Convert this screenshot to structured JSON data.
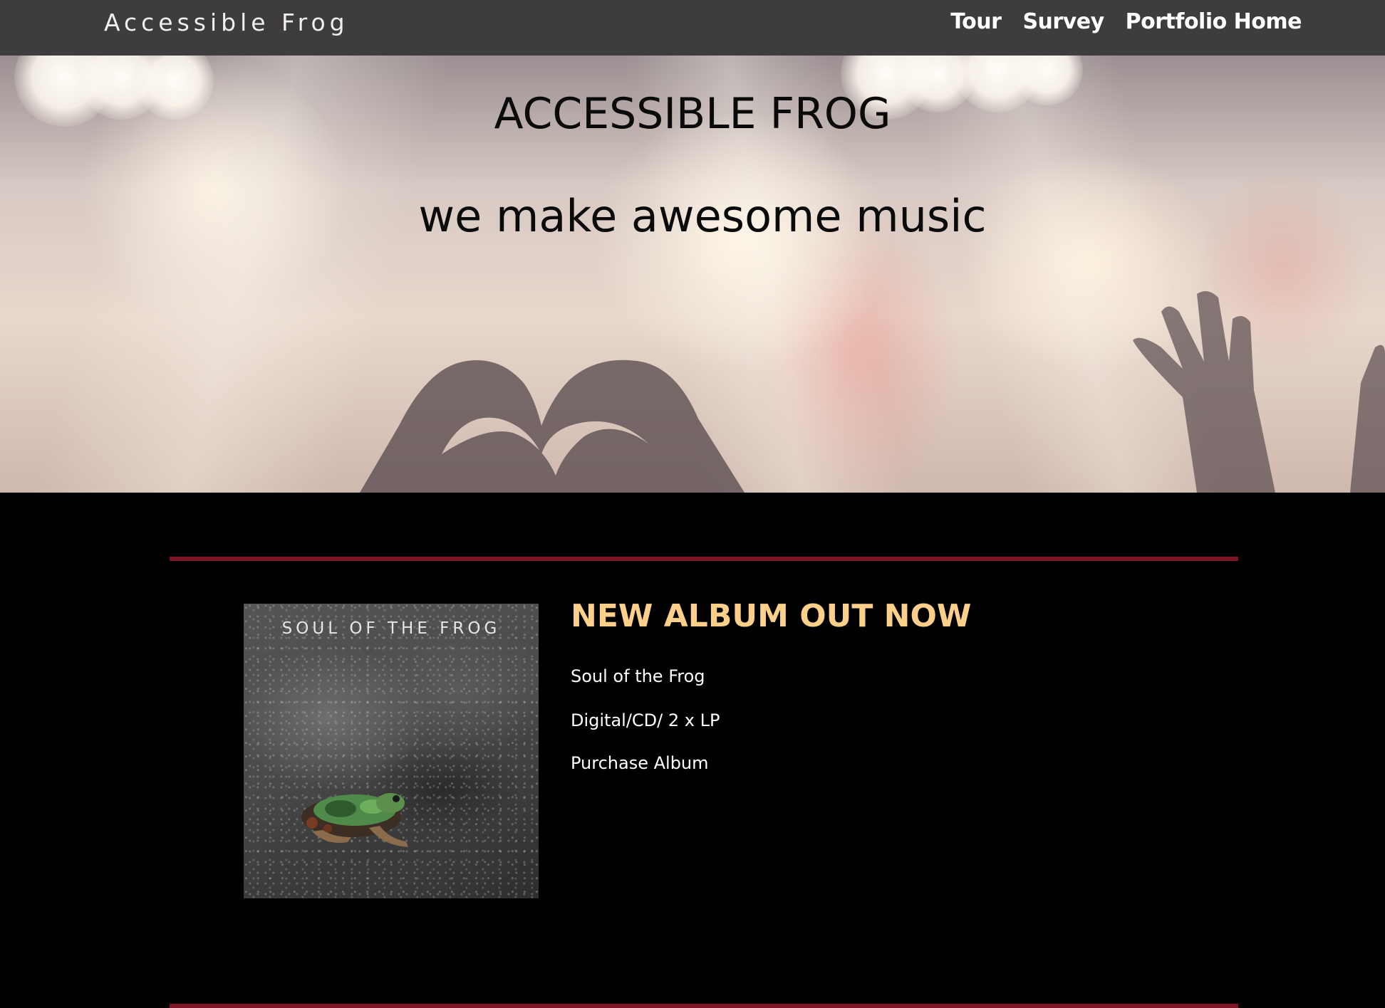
{
  "nav": {
    "brand": "Accessible Frog",
    "links": [
      "Tour",
      "Survey",
      "Portfolio Home"
    ]
  },
  "hero": {
    "title": "ACCESSIBLE FROG",
    "tagline": "we make awesome music"
  },
  "album": {
    "cover_title": "SOUL OF THE FROG",
    "heading": "NEW ALBUM OUT NOW",
    "name": "Soul of the Frog",
    "formats": "Digital/CD/ 2 x LP",
    "purchase_label": "Purchase Album"
  },
  "colors": {
    "navbar_background": "#3f3c3f",
    "page_background": "#000000",
    "divider": "#7e1526",
    "heading_accent": "#fccf8b",
    "body_text": "#ffffff"
  }
}
